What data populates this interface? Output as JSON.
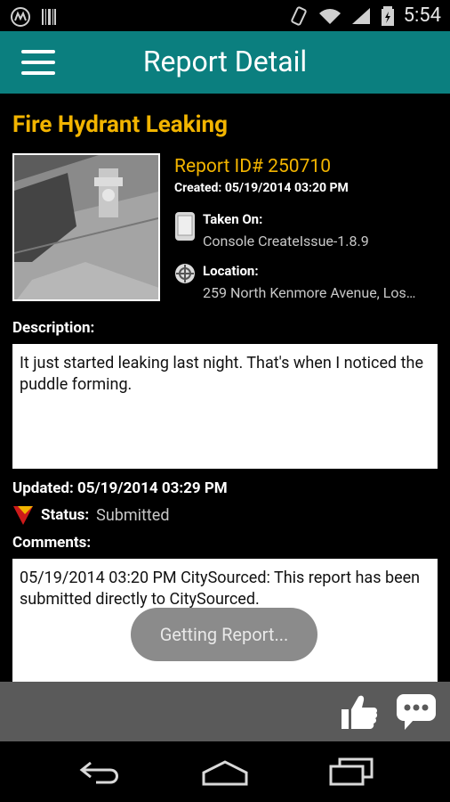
{
  "statusbar": {
    "time": "5:54"
  },
  "appbar": {
    "title": "Report Detail"
  },
  "report": {
    "title": "Fire Hydrant Leaking",
    "id_label": "Report ID# 250710",
    "created": "Created: 05/19/2014 03:20 PM",
    "taken_on_label": "Taken On:",
    "taken_on_value": "Console CreateIssue-1.8.9",
    "location_label": "Location:",
    "location_value": "259 North Kenmore Avenue, Los…",
    "description_label": "Description:",
    "description_text": "It just started leaking last night. That's when I noticed the puddle forming.",
    "updated": "Updated: 05/19/2014 03:29 PM",
    "status_label": "Status:",
    "status_value": "Submitted",
    "comments_label": "Comments:",
    "comment_text": "05/19/2014 03:20 PM CitySourced: This report has been submitted directly to CitySourced."
  },
  "toast": {
    "text": "Getting Report..."
  },
  "colors": {
    "accent": "#0b7f7f",
    "title_gold": "#f2b400"
  }
}
